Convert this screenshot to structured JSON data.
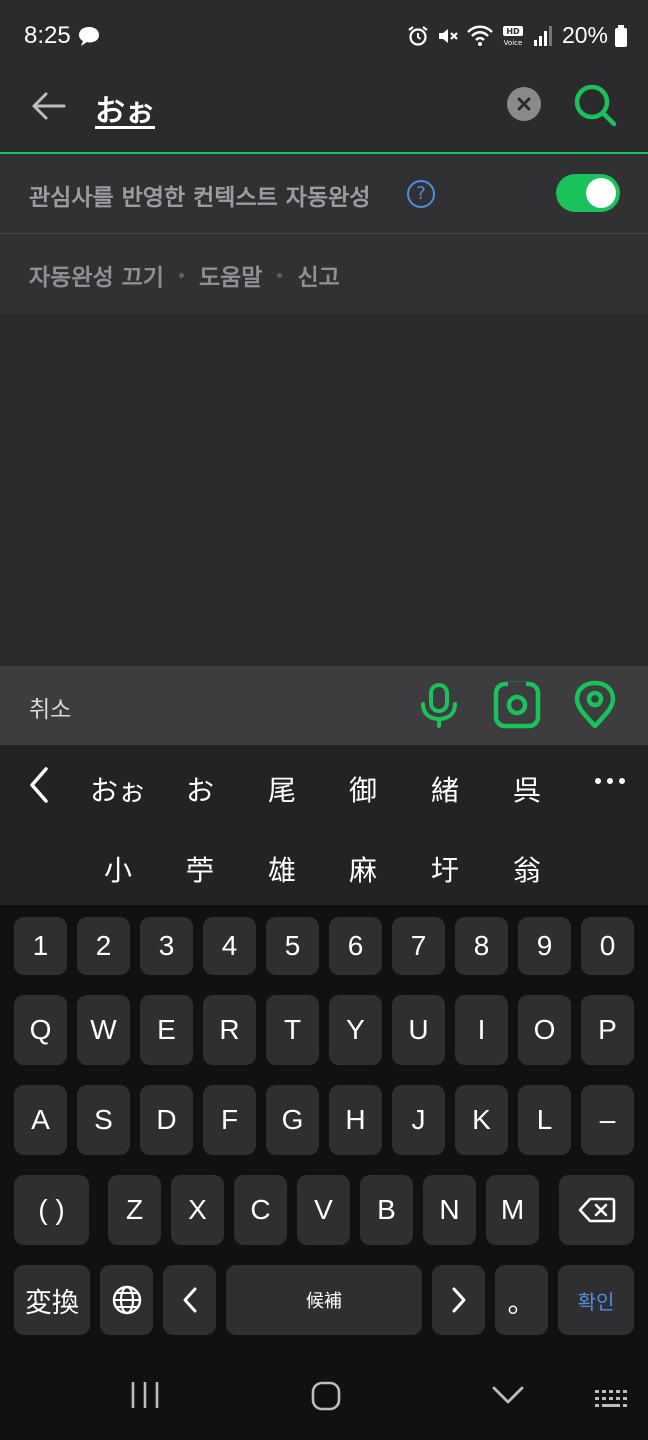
{
  "status_bar": {
    "time": "8:25",
    "battery": "20%",
    "icons": [
      "chat-bubble-icon",
      "alarm-icon",
      "mute-icon",
      "wifi-icon",
      "hd-voice-icon",
      "signal-icon",
      "battery-icon"
    ]
  },
  "search": {
    "query": "おぉ",
    "icons": [
      "back-arrow-icon",
      "clear-icon",
      "search-icon"
    ]
  },
  "suggestions": {
    "context_label": "관심사를 반영한 컨텍스트 자동완성",
    "help_symbol": "?",
    "toggle_on": true,
    "links": [
      "자동완성 끄기",
      "도움말",
      "신고"
    ]
  },
  "action_bar": {
    "cancel": "취소",
    "icons": [
      "microphone-icon",
      "lens-camera-icon",
      "location-pin-icon"
    ]
  },
  "candidates": {
    "row1": [
      "おぉ",
      "お",
      "尾",
      "御",
      "緒",
      "呉"
    ],
    "row2": [
      "小",
      "苧",
      "雄",
      "麻",
      "圩",
      "翁"
    ]
  },
  "keyboard": {
    "numbers": [
      "1",
      "2",
      "3",
      "4",
      "5",
      "6",
      "7",
      "8",
      "9",
      "0"
    ],
    "row_q": [
      "Q",
      "W",
      "E",
      "R",
      "T",
      "Y",
      "U",
      "I",
      "O",
      "P"
    ],
    "row_a": [
      "A",
      "S",
      "D",
      "F",
      "G",
      "H",
      "J",
      "K",
      "L",
      "–"
    ],
    "paren": "( )",
    "row_z": [
      "Z",
      "X",
      "C",
      "V",
      "B",
      "N",
      "M"
    ],
    "convert": "変換",
    "space": "候補",
    "punct": "。",
    "confirm": "확인"
  },
  "colors": {
    "accent": "#19c25a",
    "link_blue": "#4b8fe3",
    "panel": "#313133",
    "key": "#2f2f32"
  }
}
